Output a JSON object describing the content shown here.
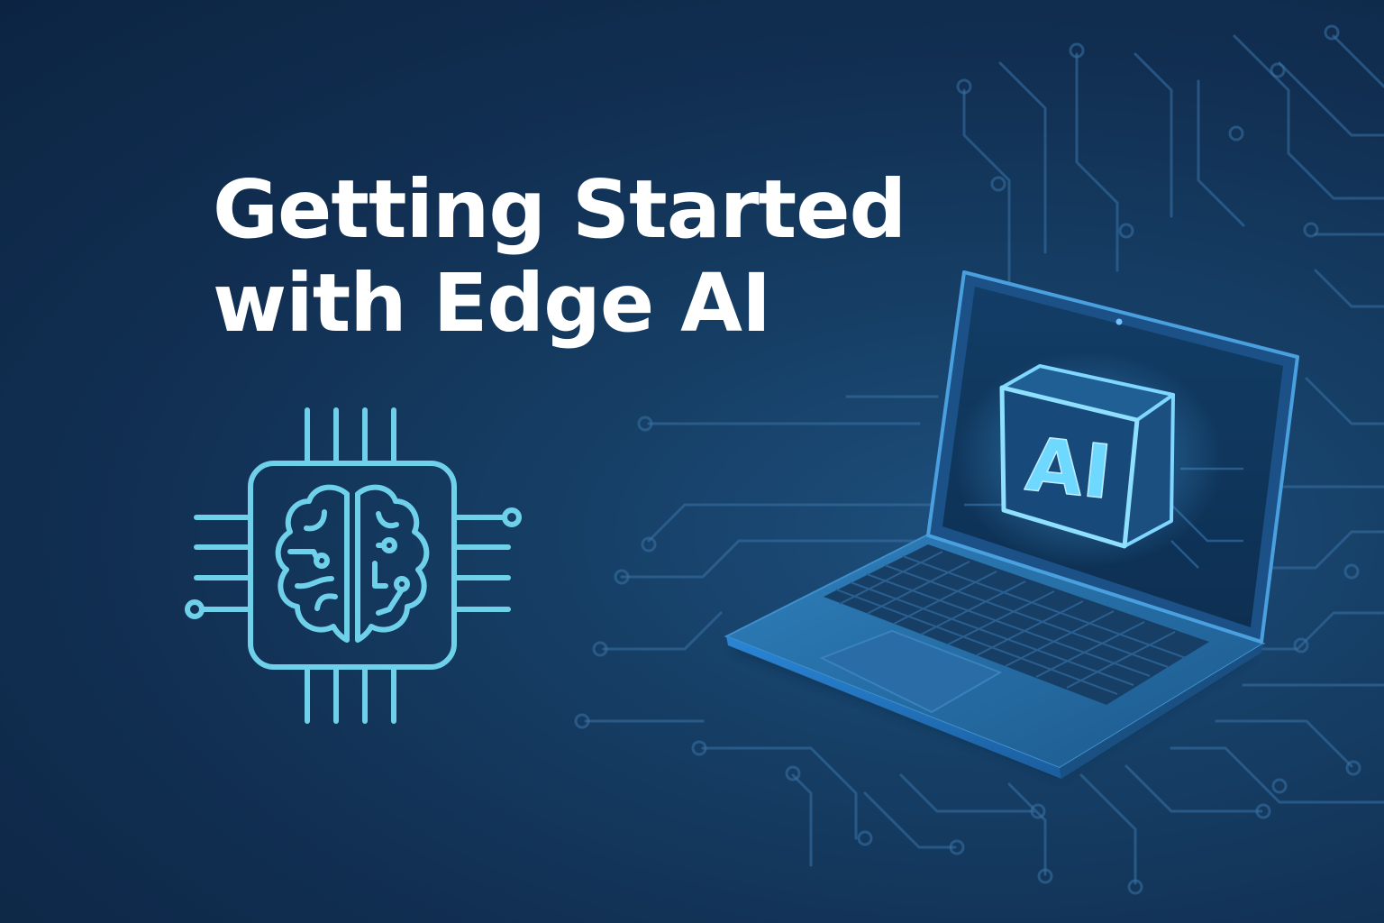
{
  "hero": {
    "title_line_1": "Getting Started",
    "title_line_2": "with Edge AI"
  },
  "laptop": {
    "screen_badge": "AI"
  },
  "icons": {
    "chip": "brain-chip-icon",
    "laptop": "laptop-icon",
    "cube": "ai-cube-icon",
    "background": "circuit-traces"
  },
  "colors": {
    "background": "#123458",
    "title": "#ffffff",
    "chip_stroke": "#6fd0ea",
    "cube_glow": "#5ec8ff",
    "circuit": "#3d79ac",
    "laptop_body": "#24689f"
  }
}
